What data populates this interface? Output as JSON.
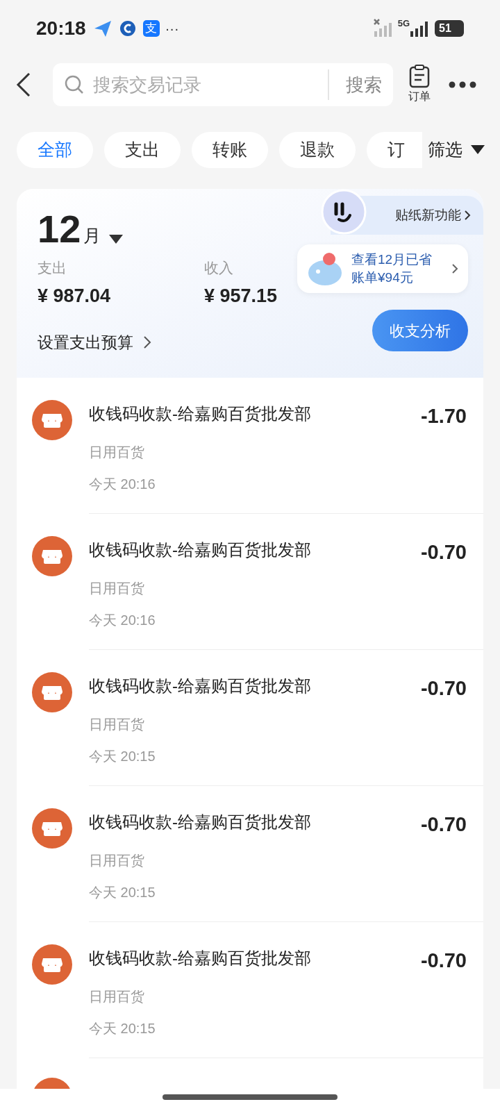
{
  "status_bar": {
    "time": "20:18",
    "app_badge": "支",
    "more": "···",
    "network": "5G",
    "battery": "51"
  },
  "header": {
    "search": {
      "placeholder": "搜索交易记录"
    },
    "search_button": "搜索",
    "orders_label": "订单"
  },
  "filters": [
    {
      "label": "全部",
      "selected": true
    },
    {
      "label": "支出",
      "selected": false
    },
    {
      "label": "转账",
      "selected": false
    },
    {
      "label": "退款",
      "selected": false
    },
    {
      "label": "订",
      "selected": false
    }
  ],
  "filter_button": "筛选",
  "summary": {
    "month": "12",
    "month_unit": "月",
    "expense_label": "支出",
    "expense": "¥ 987.04",
    "income_label": "收入",
    "income": "¥ 957.15",
    "budget_link": "设置支出预算",
    "sticker_label": "贴纸新功能",
    "savings_line1": "查看12月已省",
    "savings_line2": "账单¥94元",
    "analysis_button": "收支分析"
  },
  "transactions": [
    {
      "title": "收钱码收款-给嘉购百货批发部",
      "category": "日用百货",
      "time": "今天 20:16",
      "amount": "-1.70"
    },
    {
      "title": "收钱码收款-给嘉购百货批发部",
      "category": "日用百货",
      "time": "今天 20:16",
      "amount": "-0.70"
    },
    {
      "title": "收钱码收款-给嘉购百货批发部",
      "category": "日用百货",
      "time": "今天 20:15",
      "amount": "-0.70"
    },
    {
      "title": "收钱码收款-给嘉购百货批发部",
      "category": "日用百货",
      "time": "今天 20:15",
      "amount": "-0.70"
    },
    {
      "title": "收钱码收款-给嘉购百货批发部",
      "category": "日用百货",
      "time": "今天 20:15",
      "amount": "-0.70"
    }
  ]
}
